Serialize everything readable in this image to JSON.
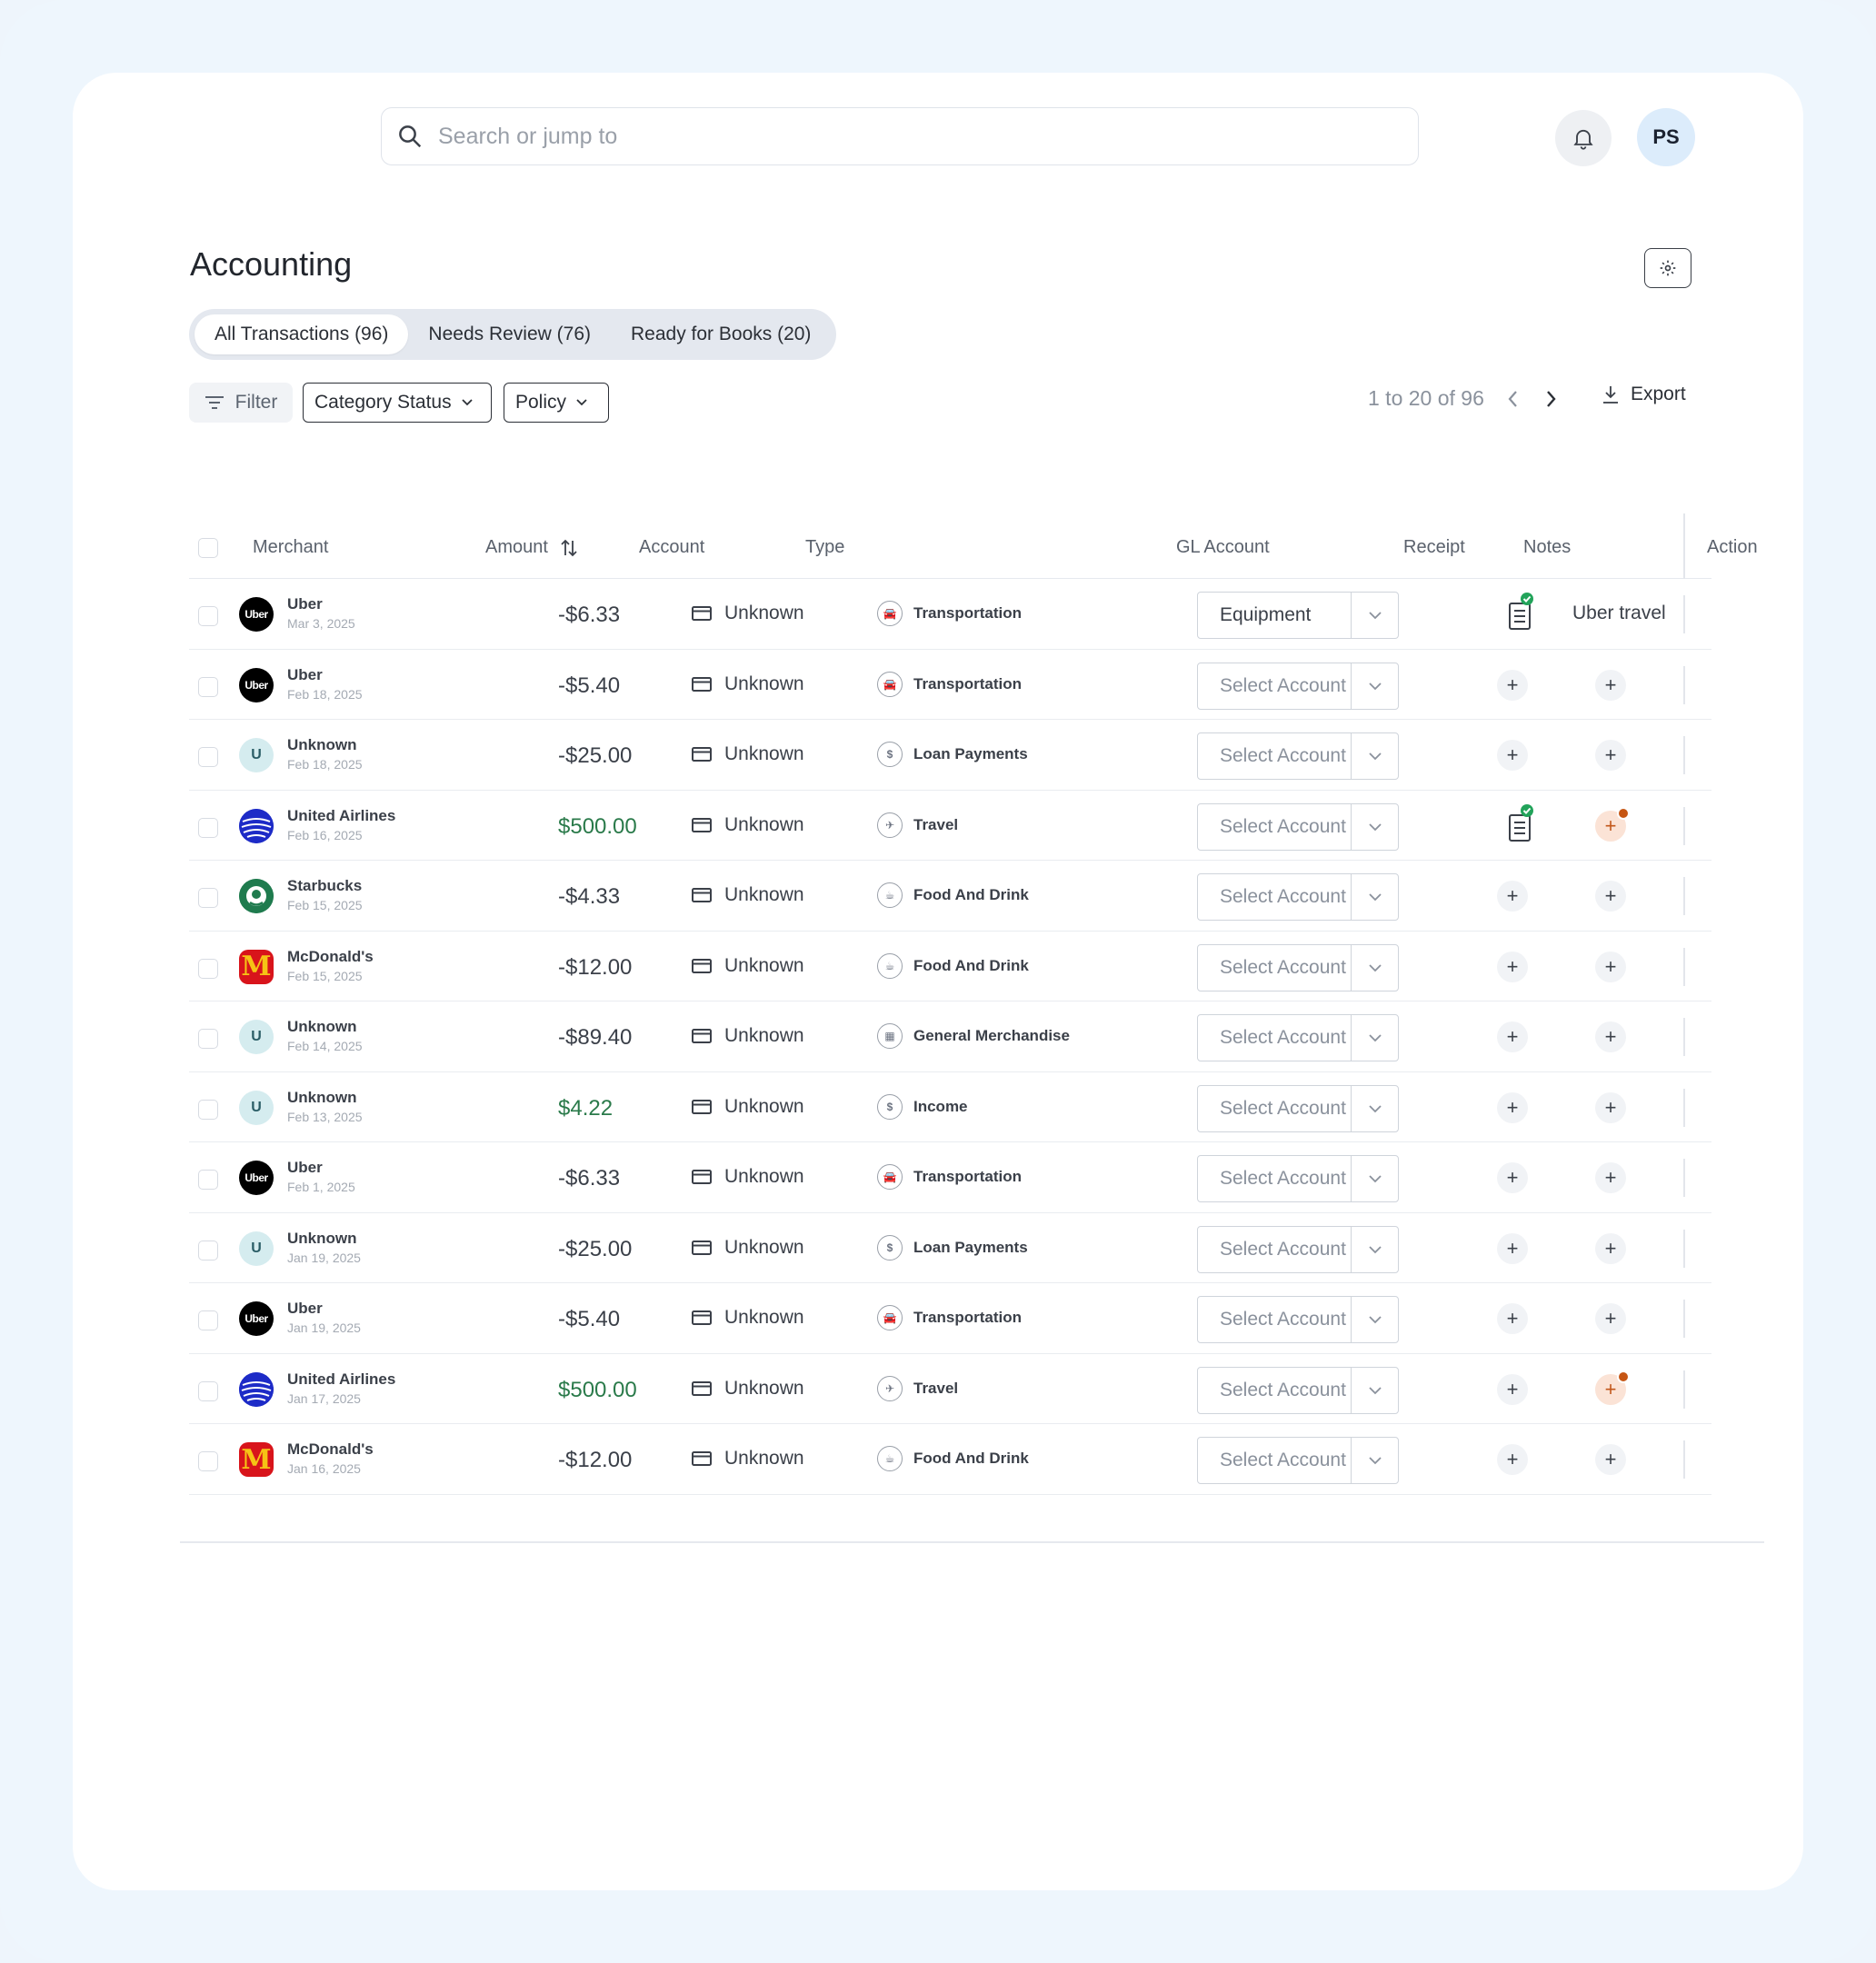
{
  "search": {
    "placeholder": "Search or jump to"
  },
  "user": {
    "initials": "PS"
  },
  "page": {
    "title": "Accounting"
  },
  "tabs": [
    {
      "label": "All Transactions (96)",
      "active": true
    },
    {
      "label": "Needs Review (76)",
      "active": false
    },
    {
      "label": "Ready for Books (20)",
      "active": false
    }
  ],
  "toolbar": {
    "filter_label": "Filter",
    "category_status_label": "Category Status",
    "policy_label": "Policy",
    "pagination": "1 to 20 of 96",
    "export_label": "Export"
  },
  "columns": {
    "merchant": "Merchant",
    "amount": "Amount",
    "account": "Account",
    "type": "Type",
    "gl_account": "GL Account",
    "receipt": "Receipt",
    "notes": "Notes",
    "action": "Action"
  },
  "colors": {
    "positive_amount": "#2a7a4a",
    "note_badge": "#c65614",
    "receipt_check": "#22a35a"
  },
  "rows": [
    {
      "merchant": "Uber",
      "logo": "uber",
      "date": "Mar 3, 2025",
      "amount": "-$6.33",
      "positive": false,
      "account": "Unknown",
      "type": "Transportation",
      "type_icon": "car-icon",
      "gl": "Equipment",
      "gl_set": true,
      "receipt": "attached",
      "note": "Uber travel"
    },
    {
      "merchant": "Uber",
      "logo": "uber",
      "date": "Feb 18, 2025",
      "amount": "-$5.40",
      "positive": false,
      "account": "Unknown",
      "type": "Transportation",
      "type_icon": "car-icon",
      "gl": "Select Account",
      "gl_set": false,
      "receipt": "add",
      "note": "add"
    },
    {
      "merchant": "Unknown",
      "logo": "unknown",
      "date": "Feb 18, 2025",
      "amount": "-$25.00",
      "positive": false,
      "account": "Unknown",
      "type": "Loan Payments",
      "type_icon": "loan-icon",
      "gl": "Select Account",
      "gl_set": false,
      "receipt": "add",
      "note": "add"
    },
    {
      "merchant": "United Airlines",
      "logo": "united",
      "date": "Feb 16, 2025",
      "amount": "$500.00",
      "positive": true,
      "account": "Unknown",
      "type": "Travel",
      "type_icon": "travel-icon",
      "gl": "Select Account",
      "gl_set": false,
      "receipt": "attached",
      "note": "flagged"
    },
    {
      "merchant": "Starbucks",
      "logo": "starbucks",
      "date": "Feb 15, 2025",
      "amount": "-$4.33",
      "positive": false,
      "account": "Unknown",
      "type": "Food And Drink",
      "type_icon": "food-icon",
      "gl": "Select Account",
      "gl_set": false,
      "receipt": "add",
      "note": "add"
    },
    {
      "merchant": "McDonald's",
      "logo": "mcd",
      "date": "Feb 15, 2025",
      "amount": "-$12.00",
      "positive": false,
      "account": "Unknown",
      "type": "Food And Drink",
      "type_icon": "food-icon",
      "gl": "Select Account",
      "gl_set": false,
      "receipt": "add",
      "note": "add"
    },
    {
      "merchant": "Unknown",
      "logo": "unknown",
      "date": "Feb 14, 2025",
      "amount": "-$89.40",
      "positive": false,
      "account": "Unknown",
      "type": "General Merchandise",
      "type_icon": "merchandise-icon",
      "gl": "Select Account",
      "gl_set": false,
      "receipt": "add",
      "note": "add"
    },
    {
      "merchant": "Unknown",
      "logo": "unknown",
      "date": "Feb 13, 2025",
      "amount": "$4.22",
      "positive": true,
      "account": "Unknown",
      "type": "Income",
      "type_icon": "income-icon",
      "gl": "Select Account",
      "gl_set": false,
      "receipt": "add",
      "note": "add"
    },
    {
      "merchant": "Uber",
      "logo": "uber",
      "date": "Feb 1, 2025",
      "amount": "-$6.33",
      "positive": false,
      "account": "Unknown",
      "type": "Transportation",
      "type_icon": "car-icon",
      "gl": "Select Account",
      "gl_set": false,
      "receipt": "add",
      "note": "add"
    },
    {
      "merchant": "Unknown",
      "logo": "unknown",
      "date": "Jan 19, 2025",
      "amount": "-$25.00",
      "positive": false,
      "account": "Unknown",
      "type": "Loan Payments",
      "type_icon": "loan-icon",
      "gl": "Select Account",
      "gl_set": false,
      "receipt": "add",
      "note": "add"
    },
    {
      "merchant": "Uber",
      "logo": "uber",
      "date": "Jan 19, 2025",
      "amount": "-$5.40",
      "positive": false,
      "account": "Unknown",
      "type": "Transportation",
      "type_icon": "car-icon",
      "gl": "Select Account",
      "gl_set": false,
      "receipt": "add",
      "note": "add"
    },
    {
      "merchant": "United Airlines",
      "logo": "united",
      "date": "Jan 17, 2025",
      "amount": "$500.00",
      "positive": true,
      "account": "Unknown",
      "type": "Travel",
      "type_icon": "travel-icon",
      "gl": "Select Account",
      "gl_set": false,
      "receipt": "add",
      "note": "flagged"
    },
    {
      "merchant": "McDonald's",
      "logo": "mcd",
      "date": "Jan 16, 2025",
      "amount": "-$12.00",
      "positive": false,
      "account": "Unknown",
      "type": "Food And Drink",
      "type_icon": "food-icon",
      "gl": "Select Account",
      "gl_set": false,
      "receipt": "add",
      "note": "add"
    }
  ]
}
